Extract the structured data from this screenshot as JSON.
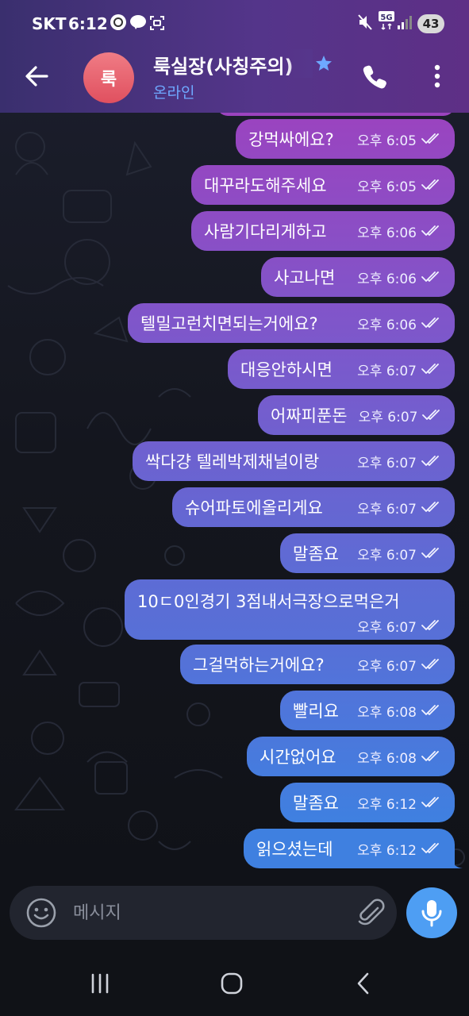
{
  "status_bar": {
    "carrier": "SKT",
    "time": "6:12",
    "network": "5G",
    "battery": "43"
  },
  "header": {
    "avatar_letter": "룩",
    "contact_name": "룩실장(사칭주의)",
    "contact_status": "온라인"
  },
  "messages": [
    {
      "text": "강먹싸에요?",
      "time": "오후 6:05"
    },
    {
      "text": "대꾸라도해주세요",
      "time": "오후 6:05"
    },
    {
      "text": "사람기다리게하고",
      "time": "오후 6:06"
    },
    {
      "text": "사고나면",
      "time": "오후 6:06"
    },
    {
      "text": "텔밀고런치면되는거에요?",
      "time": "오후 6:06"
    },
    {
      "text": "대응안하시면",
      "time": "오후 6:07"
    },
    {
      "text": "어짜피푼돈",
      "time": "오후 6:07"
    },
    {
      "text": "싹다걍 텔레박제채널이랑",
      "time": "오후 6:07"
    },
    {
      "text": "슈어파토에올리게요",
      "time": "오후 6:07"
    },
    {
      "text": "말좀요",
      "time": "오후 6:07"
    },
    {
      "text": "10ㄷ0인경기 3점내서극장으로먹은거",
      "time": "오후 6:07"
    },
    {
      "text": "그걸먹하는거에요?",
      "time": "오후 6:07"
    },
    {
      "text": "빨리요",
      "time": "오후 6:08"
    },
    {
      "text": "시간없어요",
      "time": "오후 6:08"
    },
    {
      "text": "말좀요",
      "time": "오후 6:12"
    },
    {
      "text": "읽으셨는데",
      "time": "오후 6:12"
    }
  ],
  "composer": {
    "placeholder": "메시지"
  },
  "icons": {
    "back": "back-arrow-icon",
    "star": "star-icon",
    "call": "phone-icon",
    "more": "more-vert-icon",
    "emoji": "emoji-icon",
    "attach": "paperclip-icon",
    "mic": "microphone-icon"
  },
  "colors": {
    "header_start": "#3a2f6e",
    "header_end": "#5e2f86",
    "bubble_top": "#9a44c0",
    "bubble_bottom": "#3f80e0",
    "accent": "#4e9ef3",
    "status_online": "#6ea8ff"
  }
}
